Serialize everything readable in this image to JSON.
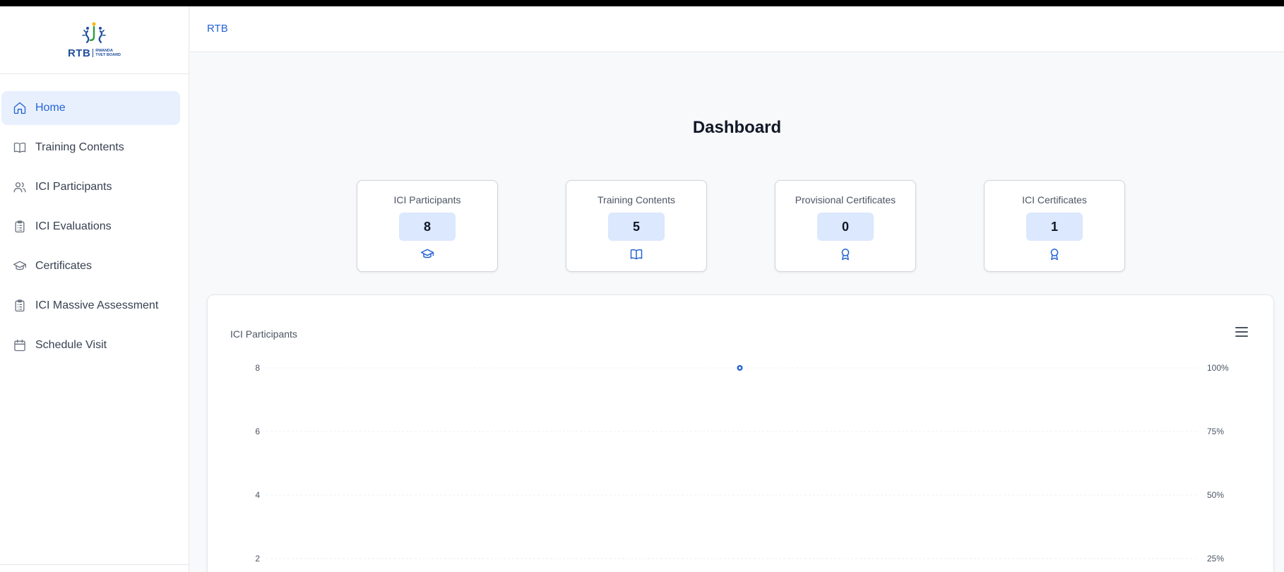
{
  "sidebar": {
    "logo": {
      "acronym": "RTB",
      "line1": "RWANDA",
      "line2": "TVET BOARD"
    },
    "items": [
      {
        "label": "Home",
        "icon": "home-icon",
        "active": true
      },
      {
        "label": "Training Contents",
        "icon": "book-icon",
        "active": false
      },
      {
        "label": "ICI Participants",
        "icon": "users-icon",
        "active": false
      },
      {
        "label": "ICI Evaluations",
        "icon": "clipboard-icon",
        "active": false
      },
      {
        "label": "Certificates",
        "icon": "graduation-cap-icon",
        "active": false
      },
      {
        "label": "ICI Massive Assessment",
        "icon": "clipboard-icon",
        "active": false
      },
      {
        "label": "Schedule Visit",
        "icon": "calendar-icon",
        "active": false
      }
    ]
  },
  "header": {
    "breadcrumb": "RTB"
  },
  "main": {
    "title": "Dashboard",
    "stats": [
      {
        "label": "ICI Participants",
        "value": "8",
        "icon": "graduation-cap-icon"
      },
      {
        "label": "Training Contents",
        "value": "5",
        "icon": "book-icon"
      },
      {
        "label": "Provisional Certificates",
        "value": "0",
        "icon": "award-icon"
      },
      {
        "label": "ICI Certificates",
        "value": "1",
        "icon": "award-icon"
      }
    ]
  },
  "chart": {
    "title": "ICI Participants",
    "menu_icon": "hamburger-menu-icon"
  },
  "chart_data": {
    "type": "scatter",
    "title": "ICI Participants",
    "y_ticks_left": [
      "8",
      "6",
      "4",
      "2"
    ],
    "y_ticks_right": [
      "100%",
      "75%",
      "50%",
      "25%"
    ],
    "ylim": [
      0,
      8
    ],
    "points": [
      {
        "y": 8
      }
    ],
    "color": "#2563d6"
  },
  "colors": {
    "accent": "#2563d6",
    "active_bg": "#e8f0fd",
    "value_bg": "#dbe8fd"
  }
}
